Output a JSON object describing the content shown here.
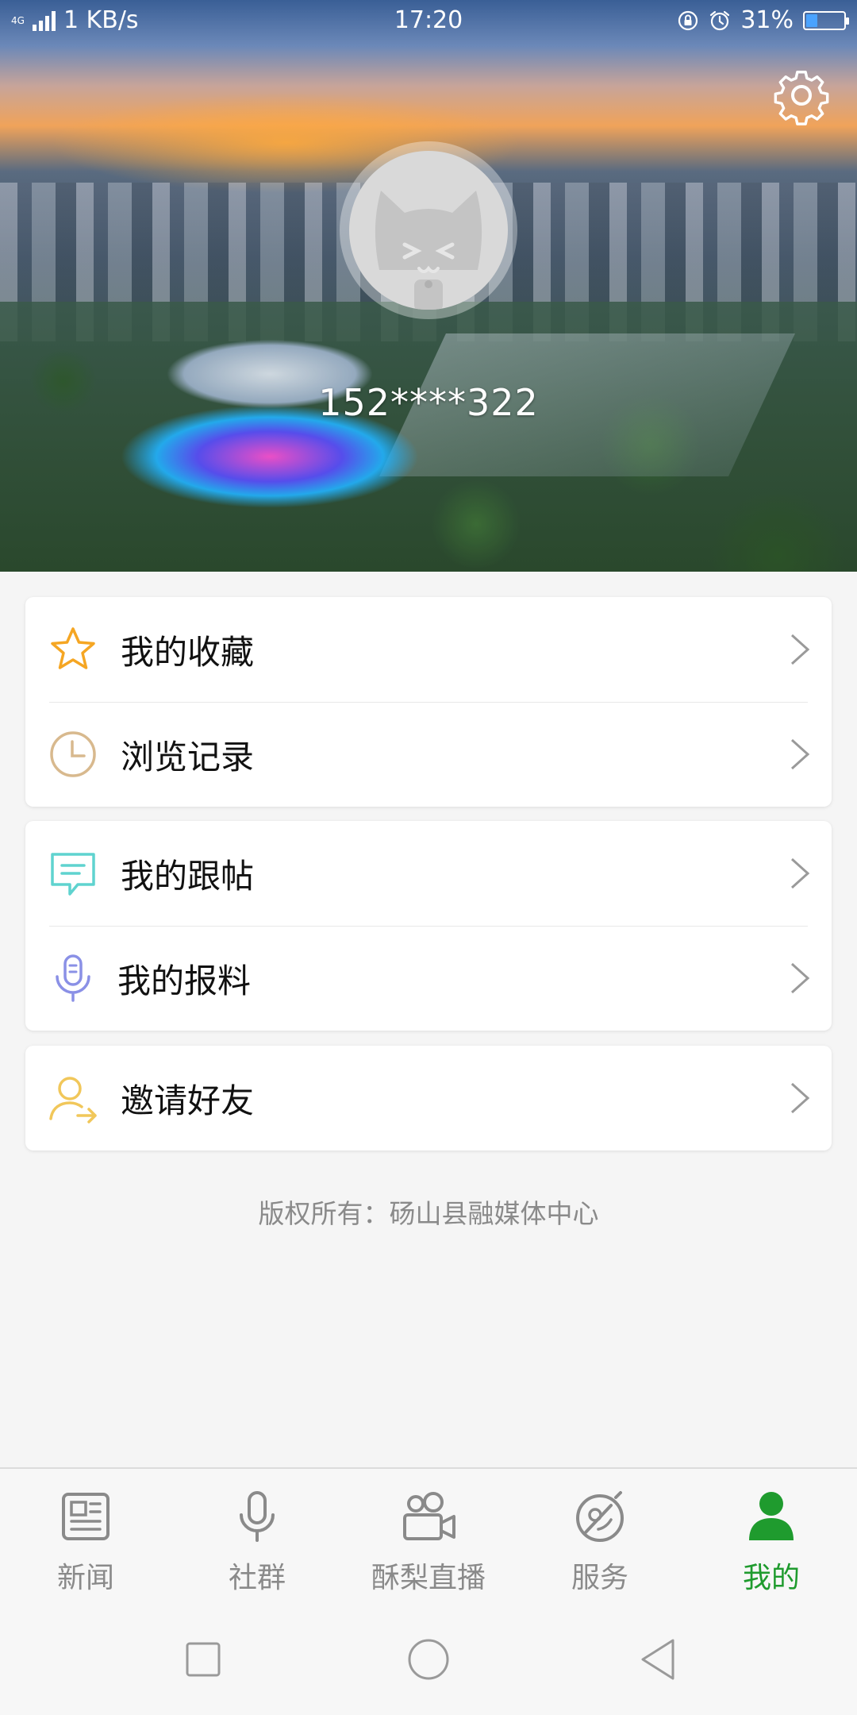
{
  "status_bar": {
    "network_type": "4G",
    "speed": "1 KB/s",
    "time": "17:20",
    "battery_percent": "31%",
    "battery_level": 0.31
  },
  "profile": {
    "phone": "152****322"
  },
  "menu": {
    "group1": [
      {
        "label": "我的收藏",
        "icon": "star-icon"
      },
      {
        "label": "浏览记录",
        "icon": "clock-icon"
      }
    ],
    "group2": [
      {
        "label": "我的跟帖",
        "icon": "comment-icon"
      },
      {
        "label": "我的报料",
        "icon": "microphone-icon"
      }
    ],
    "group3": [
      {
        "label": "邀请好友",
        "icon": "invite-user-icon"
      }
    ]
  },
  "footer": {
    "copyright": "版权所有：砀山县融媒体中心"
  },
  "tabs": [
    {
      "label": "新闻",
      "icon": "news-icon",
      "active": false
    },
    {
      "label": "社群",
      "icon": "microphone-icon",
      "active": false
    },
    {
      "label": "酥梨直播",
      "icon": "video-camera-icon",
      "active": false
    },
    {
      "label": "服务",
      "icon": "compass-icon",
      "active": false
    },
    {
      "label": "我的",
      "icon": "person-icon",
      "active": true
    }
  ],
  "colors": {
    "accent_green": "#1f9b2e",
    "star_orange": "#f5a623",
    "clock_tan": "#d8b98e",
    "comment_teal": "#5fd3cf",
    "mic_purple": "#8a90e6",
    "invite_yellow": "#f1c75a"
  }
}
